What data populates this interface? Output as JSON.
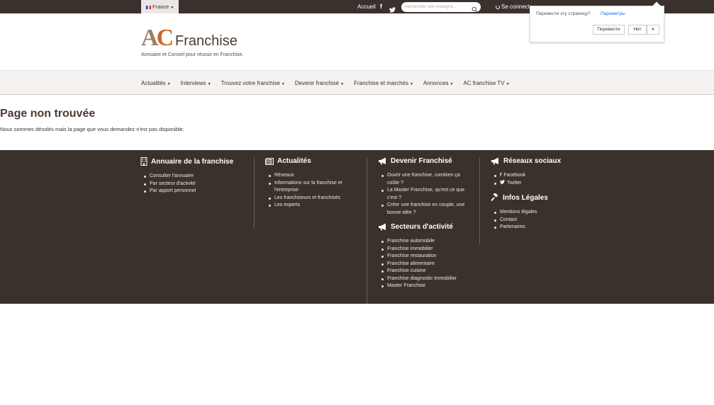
{
  "topbar": {
    "lang_label": "France",
    "accueil": "Accueil",
    "facebook_glyph": "f",
    "search_placeholder": "Rechercher une enseigne...",
    "connect_label": "Se connect"
  },
  "translate_popup": {
    "question": "Перевести эту страницу?",
    "options": "Параметры",
    "translate_button": "Перевести",
    "no_button": "Нет"
  },
  "logo": {
    "ac": "AC",
    "franchise": "Franchise",
    "tagline": "Annuaire et Conseil pour réussir en Franchise."
  },
  "nav": {
    "items": [
      {
        "label": "Actualités"
      },
      {
        "label": "Interviews"
      },
      {
        "label": "Trouvez votre franchise"
      },
      {
        "label": "Devenir franchisé"
      },
      {
        "label": "Franchise et marchés"
      },
      {
        "label": "Annonces"
      },
      {
        "label": "AC franchise TV"
      }
    ]
  },
  "content": {
    "title": "Page non trouvée",
    "message": "Nous sommes désolés mais la page que vous demandez n'est pas disponible."
  },
  "footer": {
    "annuaire": {
      "title": "Annuaire de la franchise",
      "items": [
        "Consulter l'annuaire",
        "Par secteur d'activité",
        "Par apport personnel"
      ]
    },
    "actualites": {
      "title": "Actualités",
      "items": [
        "Réseaux",
        "Informations sur la franchise et l'entreprise",
        "Les franchiseurs et franchisés",
        "Les experts"
      ]
    },
    "devenir": {
      "title": "Devenir Franchisé",
      "items": [
        "Ouvrir une franchise, combien ça coûte ?",
        "La Master Franchise, qu'est ce que c'est ?",
        "Créer une franchise en couple, une bonne idée ?"
      ]
    },
    "secteurs": {
      "title": "Secteurs d'activité",
      "items": [
        "Franchise automobile",
        "Franchise immobilier",
        "Franchise restauration",
        "Franchise alimentaire",
        "Franchise cuisine",
        "Franchise diagnostic immobilier",
        "Master Franchise"
      ]
    },
    "reseaux": {
      "title": "Réseaux sociaux",
      "items": [
        "Facebook",
        "Twitter"
      ]
    },
    "legales": {
      "title": "Infos Légales",
      "items": [
        "Mentions légales",
        "Contact",
        "Partenaires"
      ]
    }
  },
  "colors": {
    "dark_brown": "#3b312c",
    "nav_bg": "#f4f3f2",
    "logo_orange": "#c86a27"
  }
}
